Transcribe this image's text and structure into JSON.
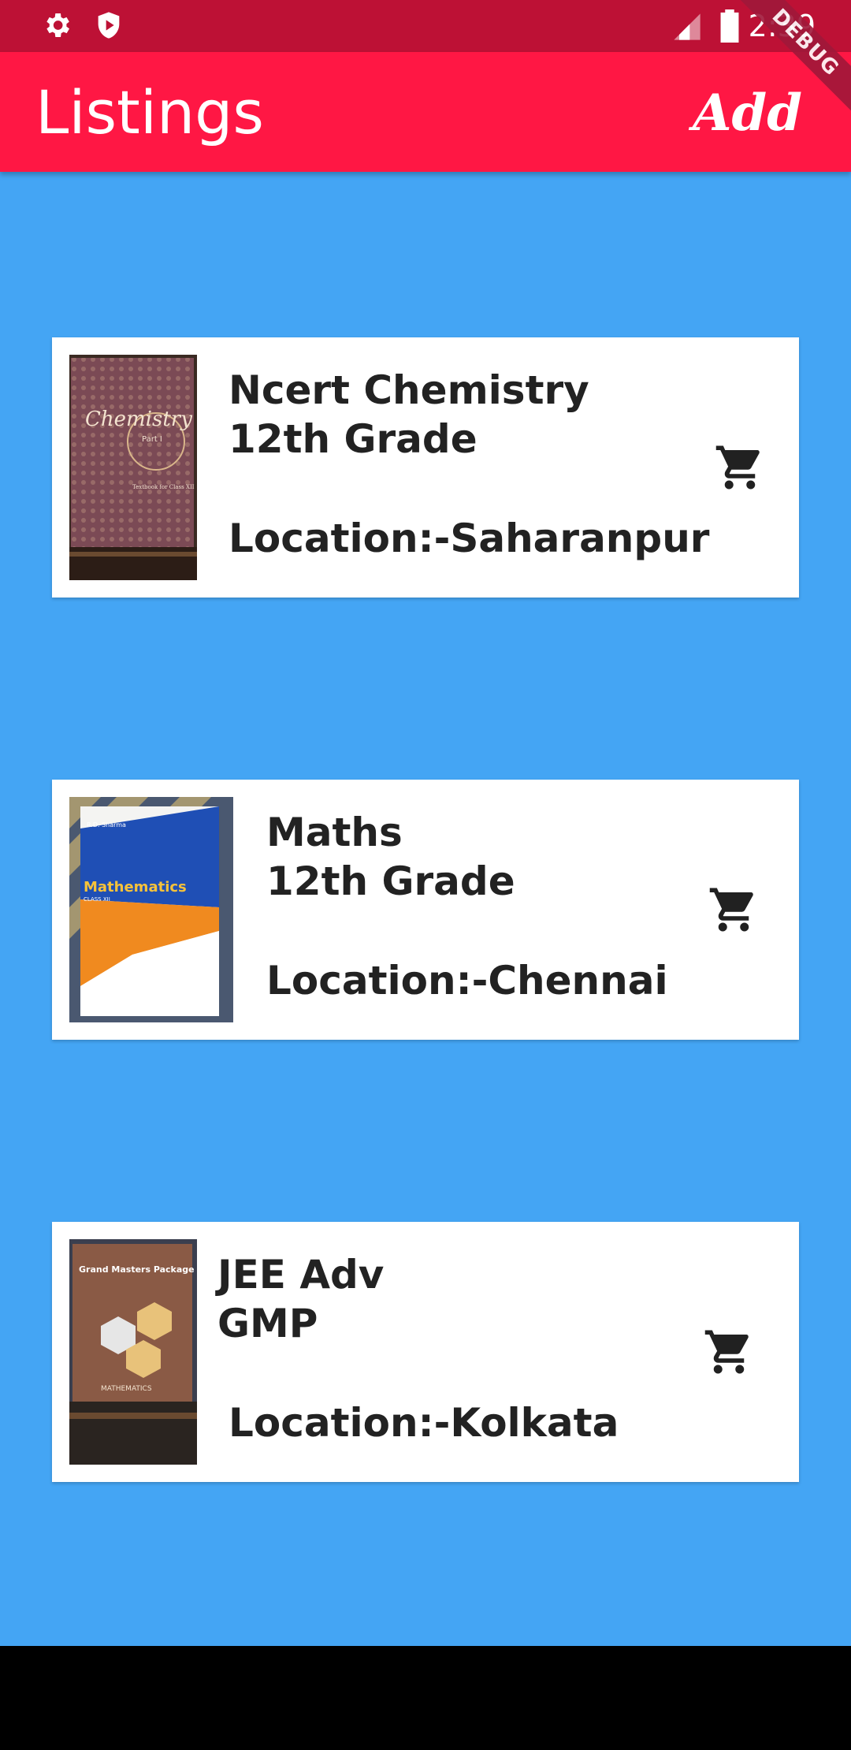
{
  "status_bar": {
    "time": "2:39"
  },
  "app_bar": {
    "title": "Listings",
    "add_label": "Add"
  },
  "debug_banner": "DEBUG",
  "listings": [
    {
      "name": "Ncert Chemistry",
      "grade": "12th Grade",
      "location": "Location:-Saharanpur",
      "cover_title": "Chemistry",
      "cover_subtitle": "Part I",
      "cover_footer": "Textbook for Class XII"
    },
    {
      "name": "Maths",
      "grade": "12th Grade",
      "location": "Location:-Chennai",
      "cover_title": "Mathematics",
      "cover_subtitle": "CLASS XII",
      "cover_author": "R.D. Sharma"
    },
    {
      "name": "JEE Adv",
      "grade": "GMP",
      "location": "Location:-Kolkata",
      "cover_title": "Grand Masters Package",
      "cover_footer": "MATHEMATICS"
    }
  ],
  "colors": {
    "status_bar": "#bd1135",
    "app_bar": "#ff1744",
    "background": "#44a5f4",
    "card": "#ffffff",
    "text": "#222222"
  },
  "icons": {
    "status_left": [
      "settings-icon",
      "shield-icon"
    ],
    "status_right": [
      "signal-icon",
      "battery-icon"
    ],
    "card_action": "shopping-cart-icon"
  }
}
